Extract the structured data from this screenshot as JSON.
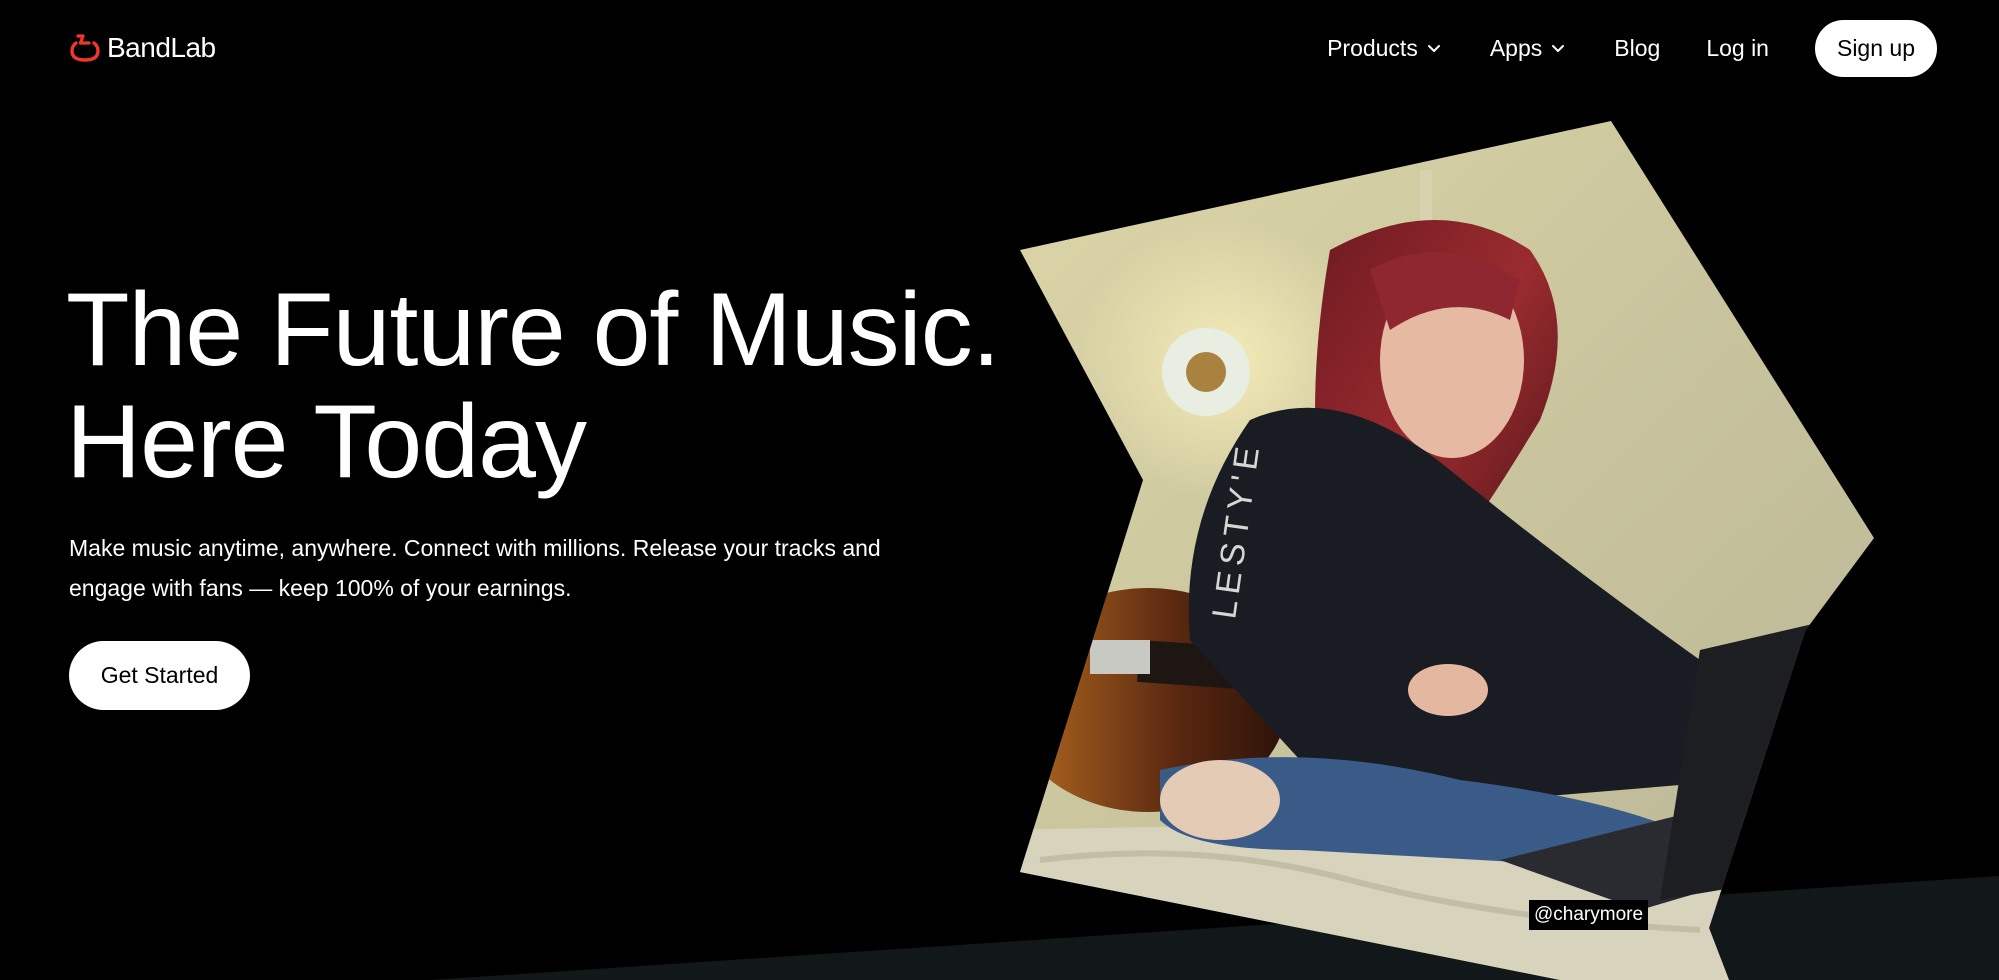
{
  "brand": {
    "name": "BandLab",
    "logo_icon": "bandlab-logo-icon",
    "accent_color": "#f0372a"
  },
  "nav": {
    "products_label": "Products",
    "apps_label": "Apps",
    "blog_label": "Blog",
    "login_label": "Log in",
    "signup_label": "Sign up",
    "dropdown_icon": "chevron-down-icon"
  },
  "hero": {
    "title_line1": "The Future of Music.",
    "title_line2": "Here Today",
    "description": "Make music anytime, anywhere. Connect with millions. Release your tracks and engage with fans — keep 100% of your earnings.",
    "cta_label": "Get Started",
    "photo_credit": "@charymore"
  },
  "colors": {
    "background": "#000000",
    "bottom_band": "#121719",
    "button_bg": "#ffffff",
    "button_text": "#000000"
  }
}
